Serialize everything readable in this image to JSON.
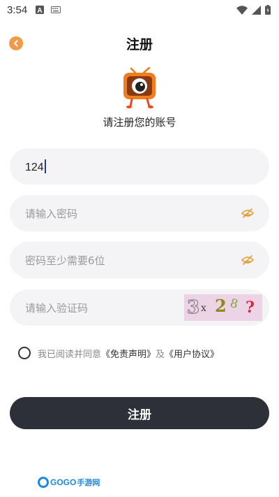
{
  "status_bar": {
    "time": "3:54",
    "icons": [
      "notification-a-icon",
      "keyboard-icon",
      "wifi-icon",
      "signal-icon",
      "battery-icon"
    ]
  },
  "header": {
    "title": "注册",
    "back_icon": "chevron-left-icon"
  },
  "logo": {
    "icon": "tv-mascot-logo"
  },
  "subtitle": "请注册您的账号",
  "form": {
    "account": {
      "value": "124"
    },
    "password": {
      "placeholder": "请输入密码",
      "icon": "eye-hidden-icon"
    },
    "confirm_password": {
      "placeholder": "密码至少需要6位",
      "icon": "eye-hidden-icon"
    },
    "verify_code": {
      "placeholder": "请输入验证码"
    }
  },
  "captcha": {
    "chars": [
      "3",
      "x",
      "2",
      "8",
      "?"
    ]
  },
  "agreement": {
    "prefix": "我已阅读并同意",
    "disclaimer_link": "《免责声明》",
    "and": "及",
    "user_agreement_link": "《用户协议》"
  },
  "submit_label": "注册",
  "watermark": {
    "latin": "GOGO",
    "cn": "手游网"
  },
  "colors": {
    "accent_orange": "#f29a4a",
    "button_dark": "#2d3039",
    "field_bg": "#f4f4f6",
    "eye_icon": "#e0a23a",
    "captcha_bg": "#ecd3e6"
  }
}
